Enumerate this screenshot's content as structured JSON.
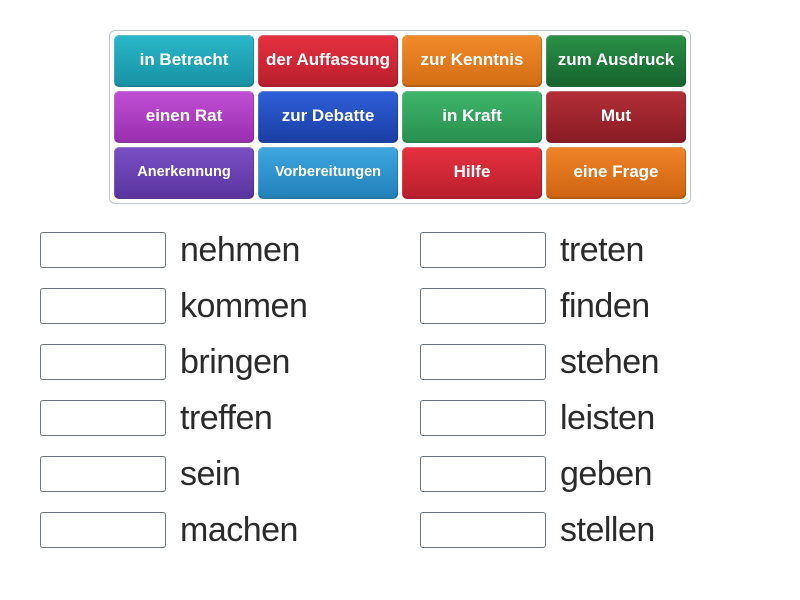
{
  "tiles": [
    {
      "label": "in Betracht",
      "color": "c-teal",
      "name": "tile-in-betracht",
      "small": false
    },
    {
      "label": "der Auffassung",
      "color": "c-red",
      "name": "tile-der-auffassung",
      "small": false
    },
    {
      "label": "zur Kenntnis",
      "color": "c-orange",
      "name": "tile-zur-kenntnis",
      "small": false
    },
    {
      "label": "zum Ausdruck",
      "color": "c-green",
      "name": "tile-zum-ausdruck",
      "small": false
    },
    {
      "label": "einen Rat",
      "color": "c-magenta",
      "name": "tile-einen-rat",
      "small": false
    },
    {
      "label": "zur Debatte",
      "color": "c-blue",
      "name": "tile-zur-debatte",
      "small": false
    },
    {
      "label": "in Kraft",
      "color": "c-midgreen",
      "name": "tile-in-kraft",
      "small": false
    },
    {
      "label": "Mut",
      "color": "c-maroon",
      "name": "tile-mut",
      "small": false
    },
    {
      "label": "Anerkennung",
      "color": "c-purple",
      "name": "tile-anerkennung",
      "small": true
    },
    {
      "label": "Vorbereitungen",
      "color": "c-skyblue",
      "name": "tile-vorbereitungen",
      "small": true
    },
    {
      "label": "Hilfe",
      "color": "c-red2",
      "name": "tile-hilfe",
      "small": false
    },
    {
      "label": "eine Frage",
      "color": "c-orange2",
      "name": "tile-eine-frage",
      "small": false
    }
  ],
  "blanks_left": [
    {
      "verb": "nehmen",
      "name": "blank-nehmen"
    },
    {
      "verb": "kommen",
      "name": "blank-kommen"
    },
    {
      "verb": "bringen",
      "name": "blank-bringen"
    },
    {
      "verb": "treffen",
      "name": "blank-treffen"
    },
    {
      "verb": "sein",
      "name": "blank-sein"
    },
    {
      "verb": "machen",
      "name": "blank-machen"
    }
  ],
  "blanks_right": [
    {
      "verb": "treten",
      "name": "blank-treten"
    },
    {
      "verb": "finden",
      "name": "blank-finden"
    },
    {
      "verb": "stehen",
      "name": "blank-stehen"
    },
    {
      "verb": "leisten",
      "name": "blank-leisten"
    },
    {
      "verb": "geben",
      "name": "blank-geben"
    },
    {
      "verb": "stellen",
      "name": "blank-stellen"
    }
  ]
}
